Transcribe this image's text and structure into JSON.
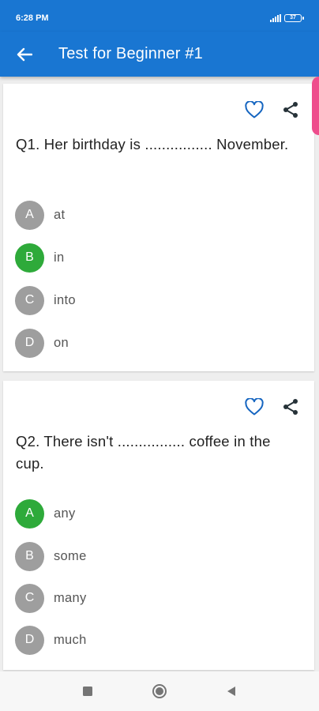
{
  "status": {
    "time": "6:28 PM",
    "battery": "37"
  },
  "header": {
    "title": "Test for Beginner #1"
  },
  "icons": {
    "back": "arrow-left",
    "favorite": "heart-outline",
    "share": "share-nodes"
  },
  "colors": {
    "primary": "#1976d2",
    "correct": "#2eaa3a",
    "neutral": "#9e9e9e",
    "accent": "#ee4d8c"
  },
  "questions": [
    {
      "text": "Q1. Her birthday is ................ November.",
      "options": [
        {
          "letter": "A",
          "text": "at",
          "correct": false
        },
        {
          "letter": "B",
          "text": "in",
          "correct": true
        },
        {
          "letter": "C",
          "text": "into",
          "correct": false
        },
        {
          "letter": "D",
          "text": "on",
          "correct": false
        }
      ]
    },
    {
      "text": "Q2. There isn't ................ coffee in the cup.",
      "options": [
        {
          "letter": "A",
          "text": "any",
          "correct": true
        },
        {
          "letter": "B",
          "text": "some",
          "correct": false
        },
        {
          "letter": "C",
          "text": "many",
          "correct": false
        },
        {
          "letter": "D",
          "text": "much",
          "correct": false
        }
      ]
    }
  ]
}
